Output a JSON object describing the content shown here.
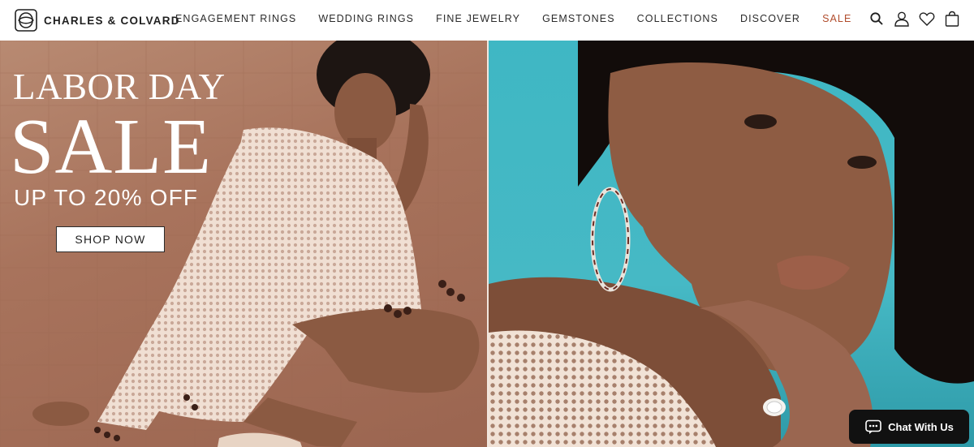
{
  "brand": {
    "name": "CHARLES & COLVARD",
    "logo_icon": "brand-logo-icon"
  },
  "nav": {
    "items": [
      {
        "label": "ENGAGEMENT RINGS"
      },
      {
        "label": "WEDDING RINGS"
      },
      {
        "label": "FINE JEWELRY"
      },
      {
        "label": "GEMSTONES"
      },
      {
        "label": "COLLECTIONS"
      },
      {
        "label": "DISCOVER"
      },
      {
        "label": "SALE"
      }
    ],
    "sale_color": "#b14c2c"
  },
  "header_icons": [
    "search-icon",
    "account-icon",
    "wishlist-icon",
    "cart-icon"
  ],
  "hero": {
    "line1": "LABOR DAY",
    "line2": "SALE",
    "subline": "UP TO 20% OFF",
    "cta": "SHOP NOW"
  },
  "chat": {
    "label": "Chat With Us",
    "icon": "chat-icon"
  },
  "colors": {
    "accent": "#b14c2c",
    "chat_bg": "#111111",
    "text": "#2b2b2b"
  }
}
